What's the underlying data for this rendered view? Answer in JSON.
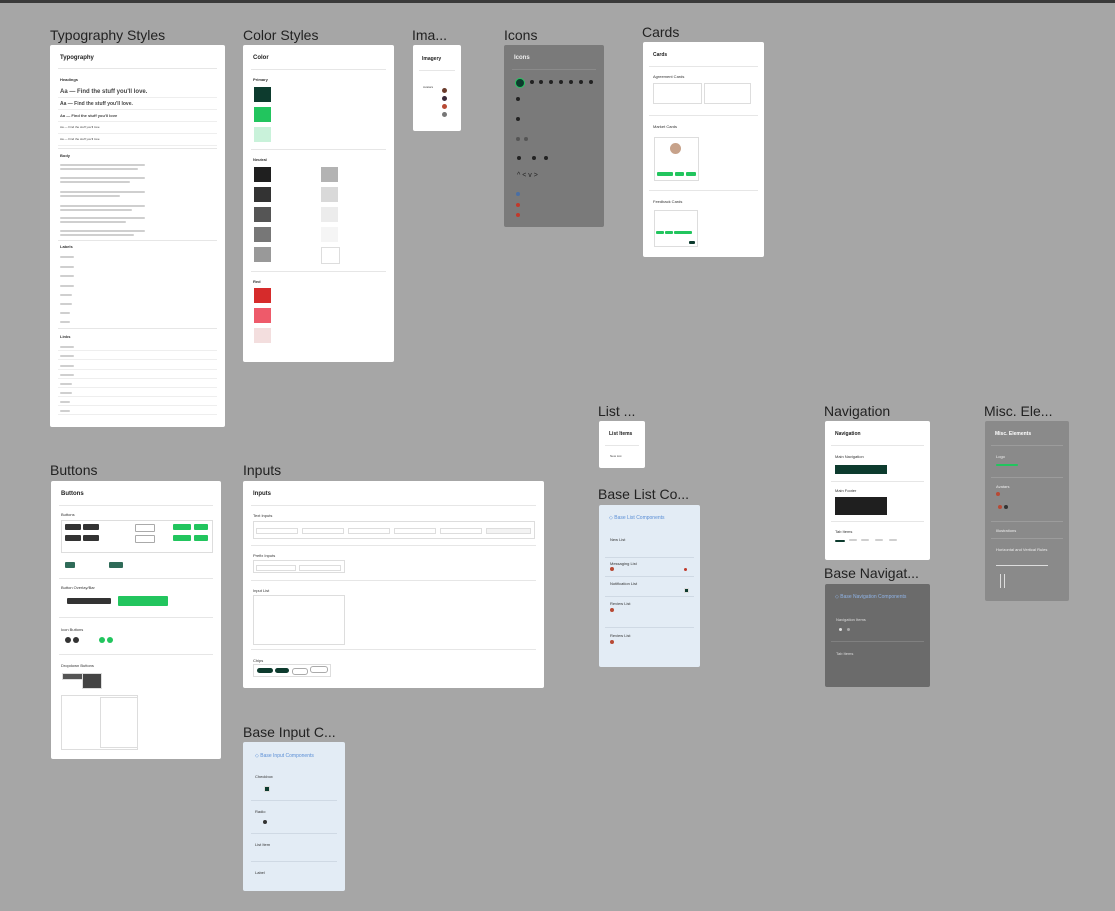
{
  "frames": {
    "typography": {
      "label": "Typography Styles",
      "title": "Typography",
      "sections": [
        "Headings",
        "Body",
        "Labels",
        "Links"
      ],
      "heading_samples": [
        "Aa — Find the stuff you'll love.",
        "Aa — Find the stuff you'll love.",
        "Aa — Find the stuff you'll love",
        "Aa — Find the stuff you'll love",
        "Aa — Find the stuff you'll love"
      ]
    },
    "color": {
      "label": "Color Styles",
      "title": "Color",
      "sections": [
        "Primary",
        "Neutral",
        "Red"
      ],
      "primary": [
        "#0d3b2e",
        "#22c55e",
        "#c9f2da"
      ],
      "neutral_left": [
        "#1f1f1f",
        "#333333",
        "#555555",
        "#777777",
        "#999999"
      ],
      "neutral_right": [
        "#b3b3b3",
        "#d9d9d9",
        "#ececec",
        "#f5f5f5",
        "#ffffff"
      ],
      "red": [
        "#d62b2b",
        "#ee5a6a",
        "#f3dede"
      ]
    },
    "imagery": {
      "label": "Ima...",
      "title": "Imagery",
      "sub": "Avatars"
    },
    "icons": {
      "label": "Icons",
      "title": "Icons"
    },
    "cards": {
      "label": "Cards",
      "title": "Cards",
      "sections": [
        "Agreement Cards",
        "Market Cards",
        "Feedback Cards"
      ]
    },
    "buttons": {
      "label": "Buttons",
      "title": "Buttons",
      "sections": [
        "Buttons",
        "Button Overlay/Bar",
        "Icon Buttons",
        "Dropdown Buttons"
      ]
    },
    "inputs": {
      "label": "Inputs",
      "title": "Inputs",
      "sections": [
        "Text Inputs",
        "Prefix Inputs",
        "Input List",
        "Chips"
      ]
    },
    "base_input": {
      "label": "Base Input C...",
      "title": "◇ Base Input Components",
      "sections": [
        "Checkbox",
        "Radio",
        "List Item",
        "Label"
      ]
    },
    "list": {
      "label": "List ...",
      "title": "List Items",
      "sub": "New List"
    },
    "base_list": {
      "label": "Base List Co...",
      "title": "◇ Base List Components",
      "sections": [
        "New List",
        "Messaging List",
        "Notification List",
        "Review List",
        "Review List"
      ]
    },
    "navigation": {
      "label": "Navigation",
      "title": "Navigation",
      "sections": [
        "Main Navigation",
        "Main Footer",
        "Tab Items"
      ]
    },
    "base_nav": {
      "label": "Base Navigat...",
      "title": "◇ Base Navigation Components",
      "sections": [
        "Navigation Items",
        "Tab Items"
      ]
    },
    "misc": {
      "label": "Misc. Ele...",
      "title": "Misc. Elements",
      "sections": [
        "Logo",
        "Avatars",
        "Illustrations",
        "Horizontal and Vertical Rules"
      ]
    }
  }
}
